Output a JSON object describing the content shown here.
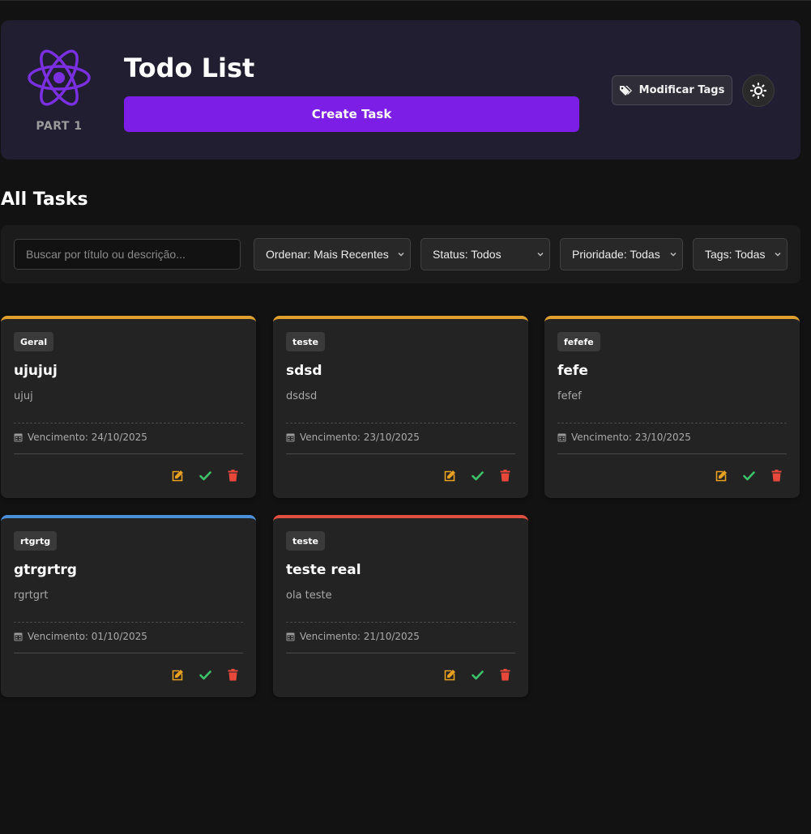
{
  "header": {
    "logo_label": "PART 1",
    "title": "Todo List",
    "create_button": "Create Task",
    "tags_button": "Modificar Tags",
    "logo_icon": "react-atom-icon",
    "theme_icon": "sun-icon"
  },
  "main": {
    "section_title": "All Tasks",
    "filters": {
      "search_placeholder": "Buscar por título ou descrição...",
      "sort": "Ordenar: Mais Recentes",
      "status": "Status: Todos",
      "priority": "Prioridade: Todas",
      "tags": "Tags: Todas"
    },
    "tasks": [
      {
        "tag": "Geral",
        "title": "ujujuj",
        "description": "ujuj",
        "due": "Vencimento: 24/10/2025",
        "priority_color": "#e0a030"
      },
      {
        "tag": "teste",
        "title": "sdsd",
        "description": "dsdsd",
        "due": "Vencimento: 23/10/2025",
        "priority_color": "#e0a030"
      },
      {
        "tag": "fefefe",
        "title": "fefe",
        "description": "fefef",
        "due": "Vencimento: 23/10/2025",
        "priority_color": "#e0a030"
      },
      {
        "tag": "rtgrtg",
        "title": "gtrgrtrg",
        "description": "rgrtgrt",
        "due": "Vencimento: 01/10/2025",
        "priority_color": "#4a90d9"
      },
      {
        "tag": "teste",
        "title": "teste real",
        "description": "ola teste",
        "due": "Vencimento: 21/10/2025",
        "priority_color": "#e05040"
      }
    ]
  },
  "colors": {
    "accent": "#7c1ee6",
    "edit": "#e8a020",
    "complete": "#3cc36a",
    "delete": "#e8483c"
  }
}
